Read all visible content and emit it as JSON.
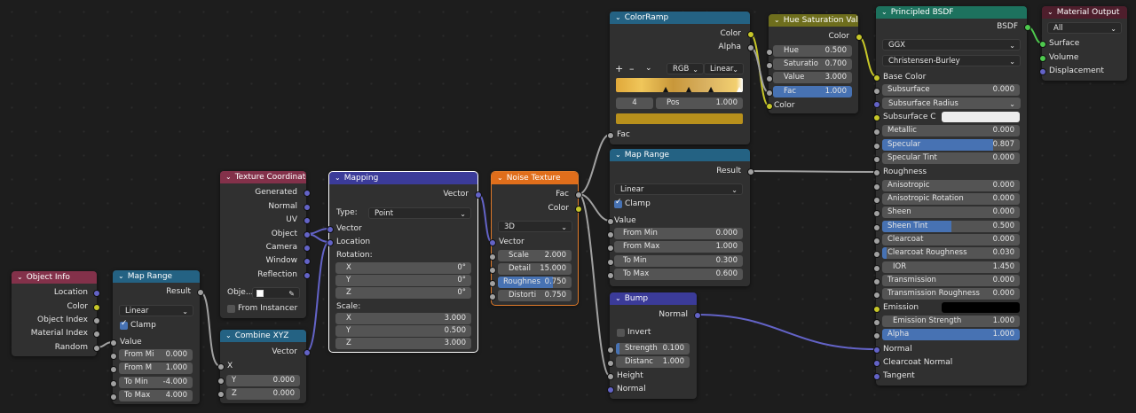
{
  "colors": {
    "header_input": "#83314a",
    "header_shader": "#1d725e",
    "header_texture": "#e06e1b",
    "header_vector": "#3b3b99",
    "header_converter": "#246283",
    "header_color": "#6e6e1d",
    "header_output": "#4e1e2c",
    "socket_gray": "#a1a1a1",
    "socket_yellow": "#c7c729",
    "socket_purple": "#6363c7",
    "socket_green": "#4ec94e",
    "accent_blue": "#4772b3"
  },
  "icons": {
    "collapse": "chevron-down-icon",
    "eyedropper": "eyedropper-icon"
  },
  "object_info": {
    "title": "Object Info",
    "outputs": [
      "Location",
      "Color",
      "Object Index",
      "Material Index",
      "Random"
    ]
  },
  "map_range_1": {
    "title": "Map Range",
    "output": "Result",
    "interp": "Linear",
    "clamp": "Clamp",
    "value": "Value",
    "fields": [
      [
        "From Mi",
        "0.000"
      ],
      [
        "From M",
        "1.000"
      ],
      [
        "To Min",
        "-4.000"
      ],
      [
        "To Max",
        "4.000"
      ]
    ]
  },
  "tex_coord": {
    "title": "Texture Coordinate",
    "outputs": [
      "Generated",
      "Normal",
      "UV",
      "Object",
      "Camera",
      "Window",
      "Reflection"
    ],
    "object_label": "Obje...",
    "instancer": "From Instancer"
  },
  "combine_xyz": {
    "title": "Combine XYZ",
    "output": "Vector",
    "x": "X",
    "y": "Y",
    "y_val": "0.000",
    "z": "Z",
    "z_val": "0.000"
  },
  "mapping": {
    "title": "Mapping",
    "output": "Vector",
    "type_label": "Type:",
    "type_value": "Point",
    "vector": "Vector",
    "location": "Location",
    "rotation": "Rotation:",
    "rot": [
      [
        "X",
        "0°"
      ],
      [
        "Y",
        "0°"
      ],
      [
        "Z",
        "0°"
      ]
    ],
    "scale": "Scale:",
    "sca": [
      [
        "X",
        "3.000"
      ],
      [
        "Y",
        "0.500"
      ],
      [
        "Z",
        "3.000"
      ]
    ]
  },
  "noise": {
    "title": "Noise Texture",
    "out_fac": "Fac",
    "out_color": "Color",
    "dims": "3D",
    "vector": "Vector",
    "fields": [
      [
        "Scale",
        "2.000"
      ],
      [
        "Detail",
        "15.000"
      ],
      [
        "Roughnes",
        "0.750"
      ],
      [
        "Distorti",
        "0.750"
      ]
    ],
    "roughness_frac": 0.75
  },
  "colorramp": {
    "title": "ColorRamp",
    "out_color": "Color",
    "out_alpha": "Alpha",
    "plus": "+",
    "minus": "–",
    "mode": "RGB",
    "interp": "Linear",
    "index": "4",
    "pos_label": "Pos",
    "pos_value": "1.000",
    "fac": "Fac"
  },
  "map_range_2": {
    "title": "Map Range",
    "output": "Result",
    "interp": "Linear",
    "clamp": "Clamp",
    "value": "Value",
    "fields": [
      [
        "From Min",
        "0.000"
      ],
      [
        "From Max",
        "1.000"
      ],
      [
        "To Min",
        "0.300"
      ],
      [
        "To Max",
        "0.600"
      ]
    ]
  },
  "hsv": {
    "title": "Hue Saturation Value",
    "out_color": "Color",
    "fields": [
      [
        "Hue",
        "0.500"
      ],
      [
        "Saturatio",
        "0.700"
      ],
      [
        "Value",
        "3.000"
      ],
      [
        "Fac",
        "1.000"
      ]
    ],
    "in_color": "Color"
  },
  "bump": {
    "title": "Bump",
    "output": "Normal",
    "invert": "Invert",
    "fields": [
      [
        "Strength",
        "0.100"
      ],
      [
        "Distanc",
        "1.000"
      ]
    ],
    "height": "Height",
    "normal": "Normal"
  },
  "bsdf": {
    "title": "Principled BSDF",
    "output": "BSDF",
    "distribution": "GGX",
    "subsurface_method": "Christensen-Burley",
    "base_color": "Base Color",
    "subsurface": [
      "Subsurface",
      "0.000"
    ],
    "subsurface_radius": "Subsurface Radius",
    "subsurface_c": "Subsurface C",
    "metallic": [
      "Metallic",
      "0.000"
    ],
    "specular": [
      "Specular",
      "0.807"
    ],
    "specular_frac": 0.807,
    "specular_tint": [
      "Specular Tint",
      "0.000"
    ],
    "roughness": "Roughness",
    "anisotropic": [
      "Anisotropic",
      "0.000"
    ],
    "aniso_rot": [
      "Anisotropic Rotation",
      "0.000"
    ],
    "sheen": [
      "Sheen",
      "0.000"
    ],
    "sheen_tint": [
      "Sheen Tint",
      "0.500"
    ],
    "sheen_frac": 0.5,
    "clearcoat": [
      "Clearcoat",
      "0.000"
    ],
    "clearcoat_rough": [
      "Clearcoat Roughness",
      "0.030"
    ],
    "clearcoat_rough_frac": 0.03,
    "ior": [
      "IOR",
      "1.450"
    ],
    "transmission": [
      "Transmission",
      "0.000"
    ],
    "trans_rough": [
      "Transmission Roughness",
      "0.000"
    ],
    "emission": "Emission",
    "emission_strength": [
      "Emission Strength",
      "1.000"
    ],
    "alpha": [
      "Alpha",
      "1.000"
    ],
    "normal": "Normal",
    "clearcoat_normal": "Clearcoat Normal",
    "tangent": "Tangent"
  },
  "output": {
    "title": "Material Output",
    "target": "All",
    "inputs": [
      "Surface",
      "Volume",
      "Displacement"
    ]
  }
}
